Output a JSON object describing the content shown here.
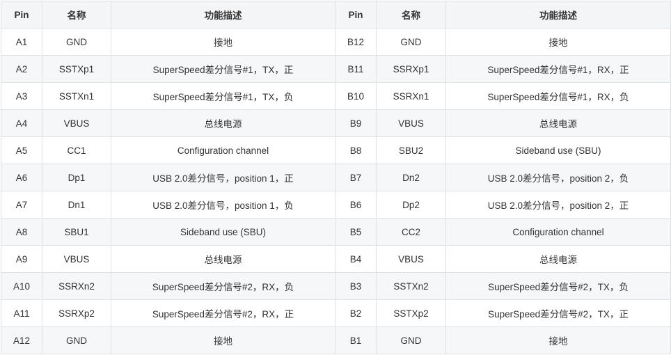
{
  "table": {
    "headers": [
      "Pin",
      "名称",
      "功能描述",
      "Pin",
      "名称",
      "功能描述"
    ],
    "rows": [
      [
        "A1",
        "GND",
        "接地",
        "B12",
        "GND",
        "接地"
      ],
      [
        "A2",
        "SSTXp1",
        "SuperSpeed差分信号#1，TX，正",
        "B11",
        "SSRXp1",
        "SuperSpeed差分信号#1，RX，正"
      ],
      [
        "A3",
        "SSTXn1",
        "SuperSpeed差分信号#1，TX，负",
        "B10",
        "SSRXn1",
        "SuperSpeed差分信号#1，RX，负"
      ],
      [
        "A4",
        "VBUS",
        "总线电源",
        "B9",
        "VBUS",
        "总线电源"
      ],
      [
        "A5",
        "CC1",
        "Configuration channel",
        "B8",
        "SBU2",
        "Sideband use (SBU)"
      ],
      [
        "A6",
        "Dp1",
        "USB 2.0差分信号，position 1，正",
        "B7",
        "Dn2",
        "USB 2.0差分信号，position 2，负"
      ],
      [
        "A7",
        "Dn1",
        "USB 2.0差分信号，position 1，负",
        "B6",
        "Dp2",
        "USB 2.0差分信号，position 2，正"
      ],
      [
        "A8",
        "SBU1",
        "Sideband use (SBU)",
        "B5",
        "CC2",
        "Configuration channel"
      ],
      [
        "A9",
        "VBUS",
        "总线电源",
        "B4",
        "VBUS",
        "总线电源"
      ],
      [
        "A10",
        "SSRXn2",
        "SuperSpeed差分信号#2，RX，负",
        "B3",
        "SSTXn2",
        "SuperSpeed差分信号#2，TX，负"
      ],
      [
        "A11",
        "SSRXp2",
        "SuperSpeed差分信号#2，RX，正",
        "B2",
        "SSTXp2",
        "SuperSpeed差分信号#2，TX，正"
      ],
      [
        "A12",
        "GND",
        "接地",
        "B1",
        "GND",
        "接地"
      ]
    ]
  }
}
